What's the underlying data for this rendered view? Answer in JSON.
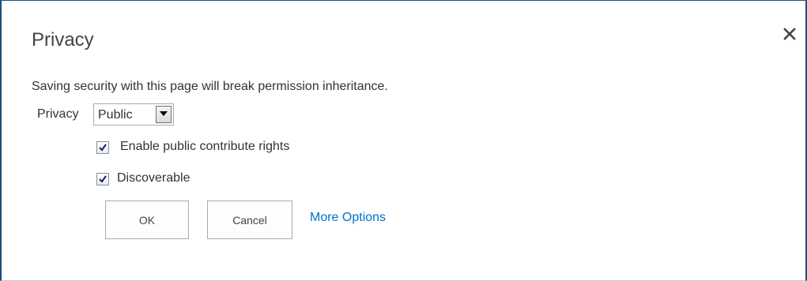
{
  "dialog": {
    "title": "Privacy",
    "close_icon": "close-icon",
    "notice": "Saving security with this page will break permission inheritance.",
    "privacy": {
      "label": "Privacy",
      "selected": "Public",
      "dropdown_icon": "chevron-down-icon"
    },
    "options": [
      {
        "label": "Enable public contribute rights",
        "checked": true
      },
      {
        "label": "Discoverable",
        "checked": true
      }
    ],
    "buttons": {
      "ok": "OK",
      "cancel": "Cancel"
    },
    "more_options": "More Options",
    "colors": {
      "border": "#1f4e79",
      "link": "#0072c6",
      "text": "#333333"
    }
  }
}
